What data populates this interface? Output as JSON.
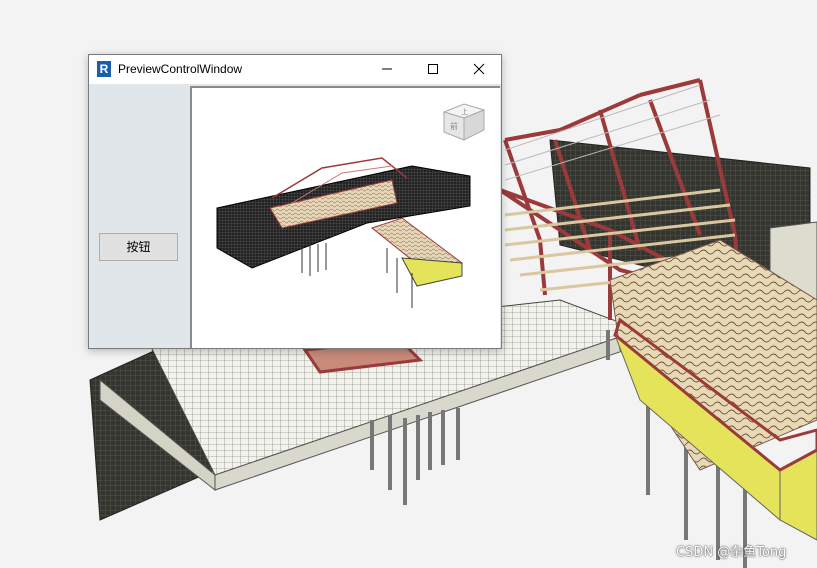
{
  "window": {
    "title": "PreviewControlWindow",
    "app_icon_letter": "R",
    "controls": {
      "minimize_icon": "minimize-icon",
      "maximize_icon": "maximize-icon",
      "close_icon": "close-icon"
    }
  },
  "left_panel": {
    "button_label": "按钮"
  },
  "view_cube": {
    "face_top": "上",
    "face_front": "前"
  },
  "watermark": "CSDN @杂鱼Tong",
  "colors": {
    "frame_red": "#9b3a3a",
    "deck_yellow": "#e4e35a",
    "wall_dark": "#2e2e2e",
    "grid_line": "#555555"
  }
}
